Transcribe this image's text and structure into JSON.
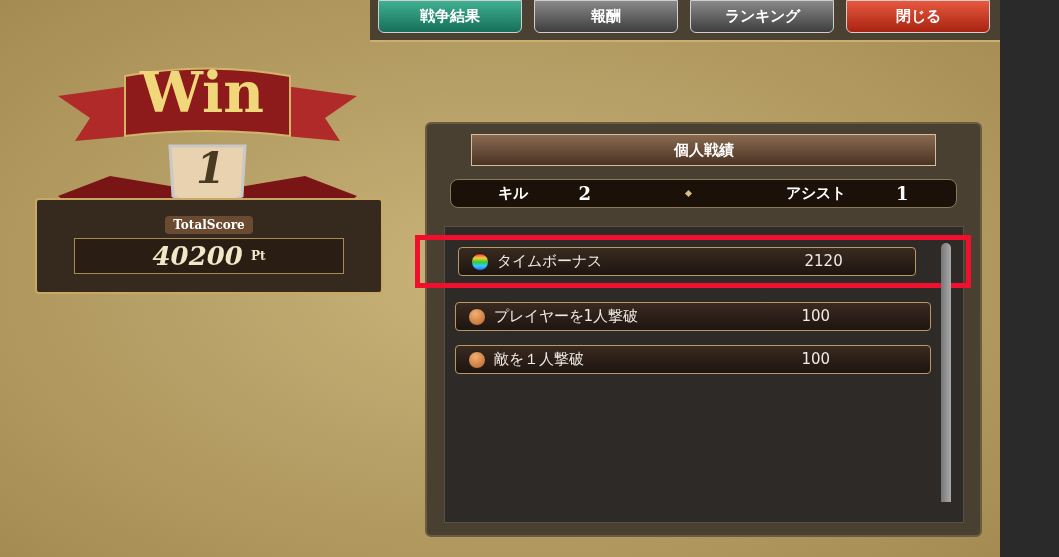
{
  "tabs": [
    {
      "label": "戦争結果",
      "selected": true
    },
    {
      "label": "報酬",
      "selected": false
    },
    {
      "label": "ランキング",
      "selected": false
    }
  ],
  "close_button": {
    "label": "閉じる"
  },
  "result": {
    "title": "Win",
    "rank": "1",
    "rank_caption": "TotalScore",
    "score": "40200",
    "unit": "Pt"
  },
  "panel": {
    "title": "個人戦績",
    "stats": [
      {
        "label": "キル",
        "value": "2"
      },
      {
        "label": "アシスト",
        "value": "1"
      }
    ],
    "rows": [
      {
        "label": "タイムボーナス",
        "value": "2120",
        "kind": "rainbow",
        "highlighted": true
      },
      {
        "label": "プレイヤーを1人撃破",
        "value": "100",
        "kind": "bronze",
        "highlighted": false
      },
      {
        "label": "敵を１人撃破",
        "value": "100",
        "kind": "bronze",
        "highlighted": false
      }
    ]
  }
}
